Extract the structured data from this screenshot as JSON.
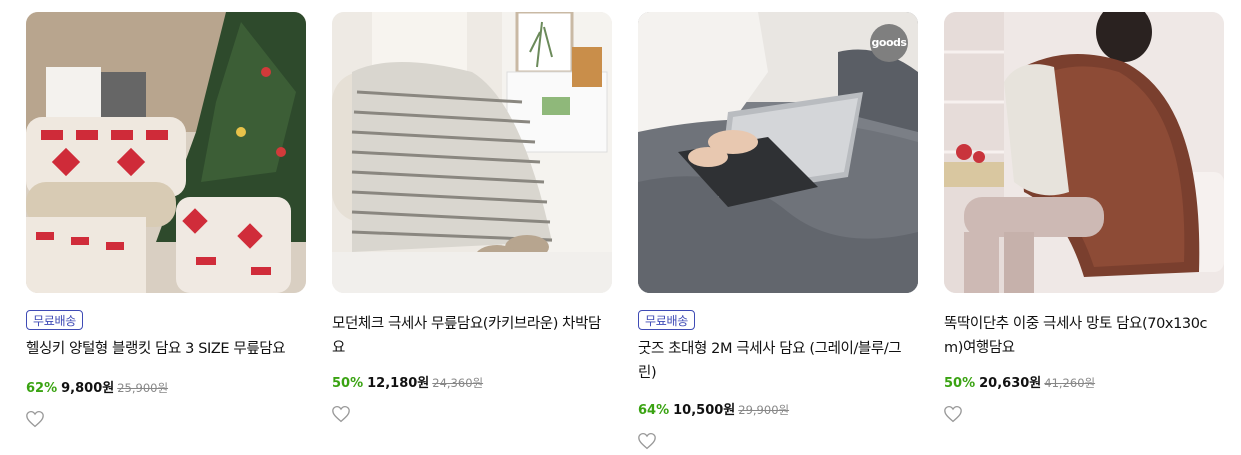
{
  "products": [
    {
      "badge": "무료배송",
      "title": "헬싱키 양털형 블랭킷 담요 3 SIZE 무릎담요",
      "discount": "62%",
      "price": "9,800원",
      "original_price": "25,900원",
      "image_desc": "christmas-blanket-photo"
    },
    {
      "badge": "",
      "title": "모던체크 극세사 무릎담요(카키브라운) 차박담요",
      "discount": "50%",
      "price": "12,180원",
      "original_price": "24,360원",
      "image_desc": "striped-lap-blanket-photo"
    },
    {
      "badge": "무료배송",
      "title": "굿즈 초대형 2M 극세사 담요 (그레이/블루/그린)",
      "discount": "64%",
      "price": "10,500원",
      "original_price": "29,900원",
      "logo_text": "goods",
      "image_desc": "grey-blanket-laptop-photo"
    },
    {
      "badge": "",
      "title": "똑딱이단추 이중 극세사 망토 담요(70x130cm)여행담요",
      "discount": "50%",
      "price": "20,630원",
      "original_price": "41,260원",
      "image_desc": "brown-cape-blanket-photo"
    }
  ],
  "colors": {
    "badge": "#3f4bb5",
    "discount": "#3aa312",
    "heart_outline": "#999999"
  }
}
